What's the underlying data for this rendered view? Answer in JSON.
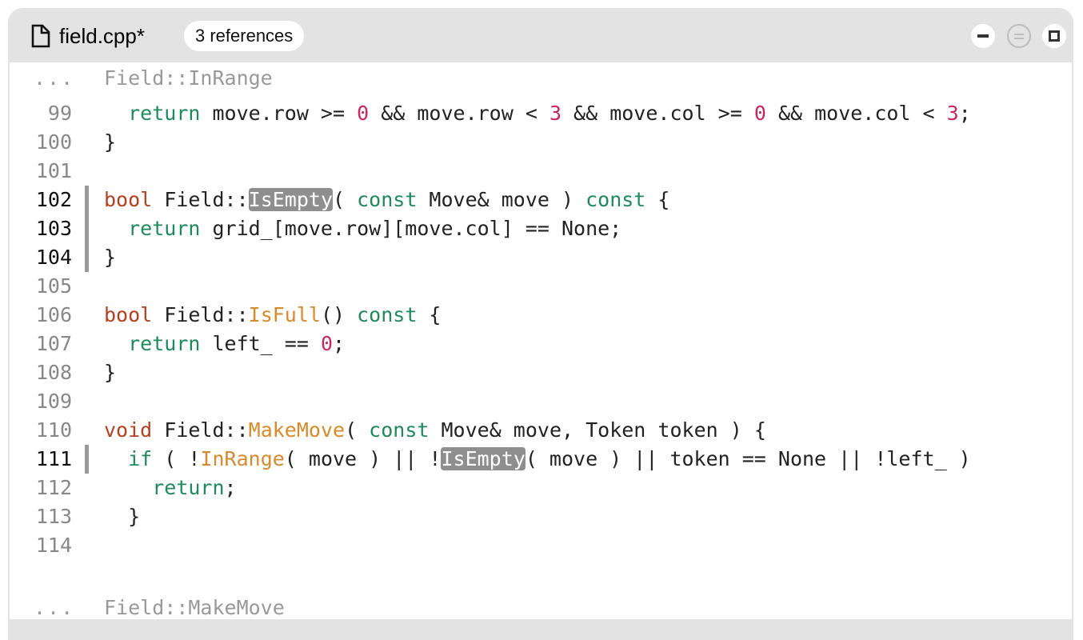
{
  "tab": {
    "file_name": "field.cpp*",
    "references": "3 references",
    "icon": "file-icon"
  },
  "window_controls": [
    "minimize-icon",
    "restore-icon",
    "maximize-icon"
  ],
  "colors": {
    "keyword_type": "#b5401f",
    "keyword": "#1f8a5b",
    "function": "#d98a2b",
    "number": "#c8285f",
    "highlight": "#8e8e8e"
  },
  "lines": [
    {
      "num": "...",
      "segments": [
        [
          "gray",
          "Field::InRange"
        ]
      ]
    },
    {
      "num": "99",
      "segments": [
        [
          "",
          "  "
        ],
        [
          "kw-green",
          "return"
        ],
        [
          "",
          " move.row >= "
        ],
        [
          "num",
          "0"
        ],
        [
          "",
          " && move.row < "
        ],
        [
          "num",
          "3"
        ],
        [
          "",
          " && move.col >= "
        ],
        [
          "num",
          "0"
        ],
        [
          "",
          " && move.col < "
        ],
        [
          "num",
          "3"
        ],
        [
          "",
          ";"
        ]
      ]
    },
    {
      "num": "100",
      "segments": [
        [
          "",
          "}"
        ]
      ]
    },
    {
      "num": "101",
      "segments": []
    },
    {
      "num": "102",
      "segments": [
        [
          "kw-red",
          "bool"
        ],
        [
          "",
          " Field::"
        ],
        [
          "hl",
          "IsEmpty"
        ],
        [
          "",
          "( "
        ],
        [
          "kw-green",
          "const"
        ],
        [
          "",
          " Move& move ) "
        ],
        [
          "kw-green",
          "const"
        ],
        [
          "",
          " {"
        ]
      ]
    },
    {
      "num": "103",
      "segments": [
        [
          "",
          "  "
        ],
        [
          "kw-green",
          "return"
        ],
        [
          "",
          " grid_[move.row][move.col] == None;"
        ]
      ]
    },
    {
      "num": "104",
      "segments": [
        [
          "",
          "}"
        ]
      ]
    },
    {
      "num": "105",
      "segments": []
    },
    {
      "num": "106",
      "segments": [
        [
          "kw-red",
          "bool"
        ],
        [
          "",
          " Field::"
        ],
        [
          "fn",
          "IsFull"
        ],
        [
          "",
          "() "
        ],
        [
          "kw-green",
          "const"
        ],
        [
          "",
          " {"
        ]
      ]
    },
    {
      "num": "107",
      "segments": [
        [
          "",
          "  "
        ],
        [
          "kw-green",
          "return"
        ],
        [
          "",
          " left_ == "
        ],
        [
          "num",
          "0"
        ],
        [
          "",
          ";"
        ]
      ]
    },
    {
      "num": "108",
      "segments": [
        [
          "",
          "}"
        ]
      ]
    },
    {
      "num": "109",
      "segments": []
    },
    {
      "num": "110",
      "segments": [
        [
          "kw-red",
          "void"
        ],
        [
          "",
          " Field::"
        ],
        [
          "fn",
          "MakeMove"
        ],
        [
          "",
          "( "
        ],
        [
          "kw-green",
          "const"
        ],
        [
          "",
          " Move& move, Token token ) {"
        ]
      ]
    },
    {
      "num": "111",
      "segments": [
        [
          "",
          "  "
        ],
        [
          "kw-green",
          "if"
        ],
        [
          "",
          " ( !"
        ],
        [
          "fn",
          "InRange"
        ],
        [
          "",
          "( move ) || !"
        ],
        [
          "hl",
          "IsEmpty"
        ],
        [
          "",
          "( move ) || token == None || !left_ )"
        ]
      ]
    },
    {
      "num": "112",
      "segments": [
        [
          "",
          "    "
        ],
        [
          "kw-green",
          "return"
        ],
        [
          "",
          ";"
        ]
      ]
    },
    {
      "num": "113",
      "segments": [
        [
          "",
          "  }"
        ]
      ]
    },
    {
      "num": "114",
      "segments": []
    },
    {
      "num": "...",
      "segments": [
        [
          "gray",
          "Field::MakeMove"
        ]
      ]
    }
  ]
}
